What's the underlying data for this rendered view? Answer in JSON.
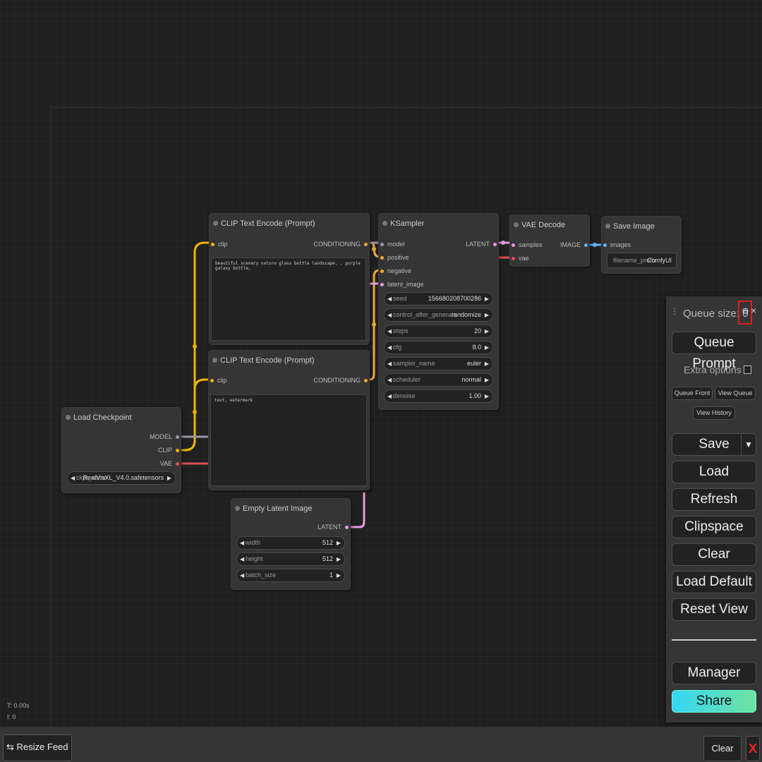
{
  "colors": {
    "clip": "#f0b400",
    "conditioning": "#f2a93b",
    "model": "#9a9aa4",
    "vae": "#e05050",
    "latent": "#e89be0",
    "image": "#64b5f6"
  },
  "nodes": {
    "clip_top": {
      "title": "CLIP Text Encode (Prompt)",
      "in_clip": "clip",
      "out": "CONDITIONING",
      "text": "beautiful scenery nature glass bottle landscape, , purple galaxy bottle,"
    },
    "clip_bottom": {
      "title": "CLIP Text Encode (Prompt)",
      "in_clip": "clip",
      "out": "CONDITIONING",
      "text": "text, watermark"
    },
    "ksampler": {
      "title": "KSampler",
      "inputs": [
        "model",
        "positive",
        "negative",
        "latent_image"
      ],
      "out": "LATENT",
      "widgets": [
        {
          "label": "seed",
          "value": "156680208700286"
        },
        {
          "label": "control_after_generate",
          "value": "randomize"
        },
        {
          "label": "steps",
          "value": "20"
        },
        {
          "label": "cfg",
          "value": "8.0"
        },
        {
          "label": "sampler_name",
          "value": "euler"
        },
        {
          "label": "scheduler",
          "value": "normal"
        },
        {
          "label": "denoise",
          "value": "1.00"
        }
      ]
    },
    "vae_decode": {
      "title": "VAE Decode",
      "in_samples": "samples",
      "in_vae": "vae",
      "out": "IMAGE"
    },
    "save_image": {
      "title": "Save Image",
      "in_images": "images",
      "prefix_label": "filename_prefix",
      "prefix_value": "ComfyUI"
    },
    "load_checkpoint": {
      "title": "Load Checkpoint",
      "out_model": "MODEL",
      "out_clip": "CLIP",
      "out_vae": "VAE",
      "ckpt_label": "ckpt_name",
      "ckpt_value": "RealVisXL_V4.0.safetensors"
    },
    "empty_latent": {
      "title": "Empty Latent Image",
      "out": "LATENT",
      "widgets": [
        {
          "label": "width",
          "value": "512"
        },
        {
          "label": "height",
          "value": "512"
        },
        {
          "label": "batch_size",
          "value": "1"
        }
      ]
    }
  },
  "menu": {
    "queue_size": "Queue size: 0",
    "queue_prompt": "Queue Prompt",
    "extra_options": "Extra options",
    "queue_front": "Queue Front",
    "view_queue": "View Queue",
    "view_history": "View History",
    "save": "Save",
    "load": "Load",
    "refresh": "Refresh",
    "clipspace": "Clipspace",
    "clear": "Clear",
    "load_default": "Load Default",
    "reset_view": "Reset View",
    "manager": "Manager",
    "share": "Share"
  },
  "stats": {
    "t": "T: 0.00s",
    "i": "I: 0"
  },
  "bottombar": {
    "resize_feed": "Resize Feed",
    "clear": "Clear",
    "close": "X"
  }
}
